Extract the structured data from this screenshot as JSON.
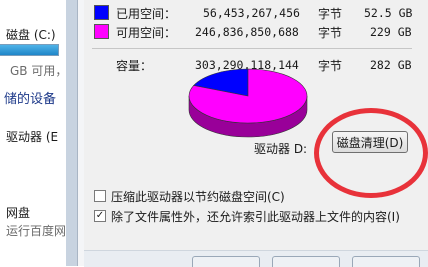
{
  "background_explorer": {
    "drive_label": "磁盘 (C:)",
    "free_text": "GB 可用，",
    "section_label": "储的设备",
    "drive_label_2": "驱动器 (E",
    "network_label": "网盘",
    "network_sub": "运行百度网"
  },
  "legend": {
    "used": {
      "label": "已用空间：",
      "bytes": "56,453,267,456",
      "unit": "字节",
      "size": "52.5 GB",
      "color": "#0000ff"
    },
    "free": {
      "label": "可用空间：",
      "bytes": "246,836,850,688",
      "unit": "字节",
      "size": "229 GB",
      "color": "#ff00ff"
    }
  },
  "capacity": {
    "label": "容量：",
    "bytes": "303,290,118,144",
    "unit": "字节",
    "size": "282 GB"
  },
  "drive": {
    "label": "驱动器 D:"
  },
  "cleanup_button": {
    "label": "磁盘清理(D)"
  },
  "options": {
    "compress": {
      "label": "压缩此驱动器以节约磁盘空间(C)",
      "checked": false
    },
    "index": {
      "label": "除了文件属性外，还允许索引此驱动器上文件的内容(I)",
      "checked": true
    }
  },
  "chart_data": {
    "type": "pie",
    "categories": [
      "已用空间",
      "可用空间"
    ],
    "values": [
      56453267456,
      246836850688
    ],
    "colors": [
      "#0000ff",
      "#ff00ff"
    ]
  }
}
